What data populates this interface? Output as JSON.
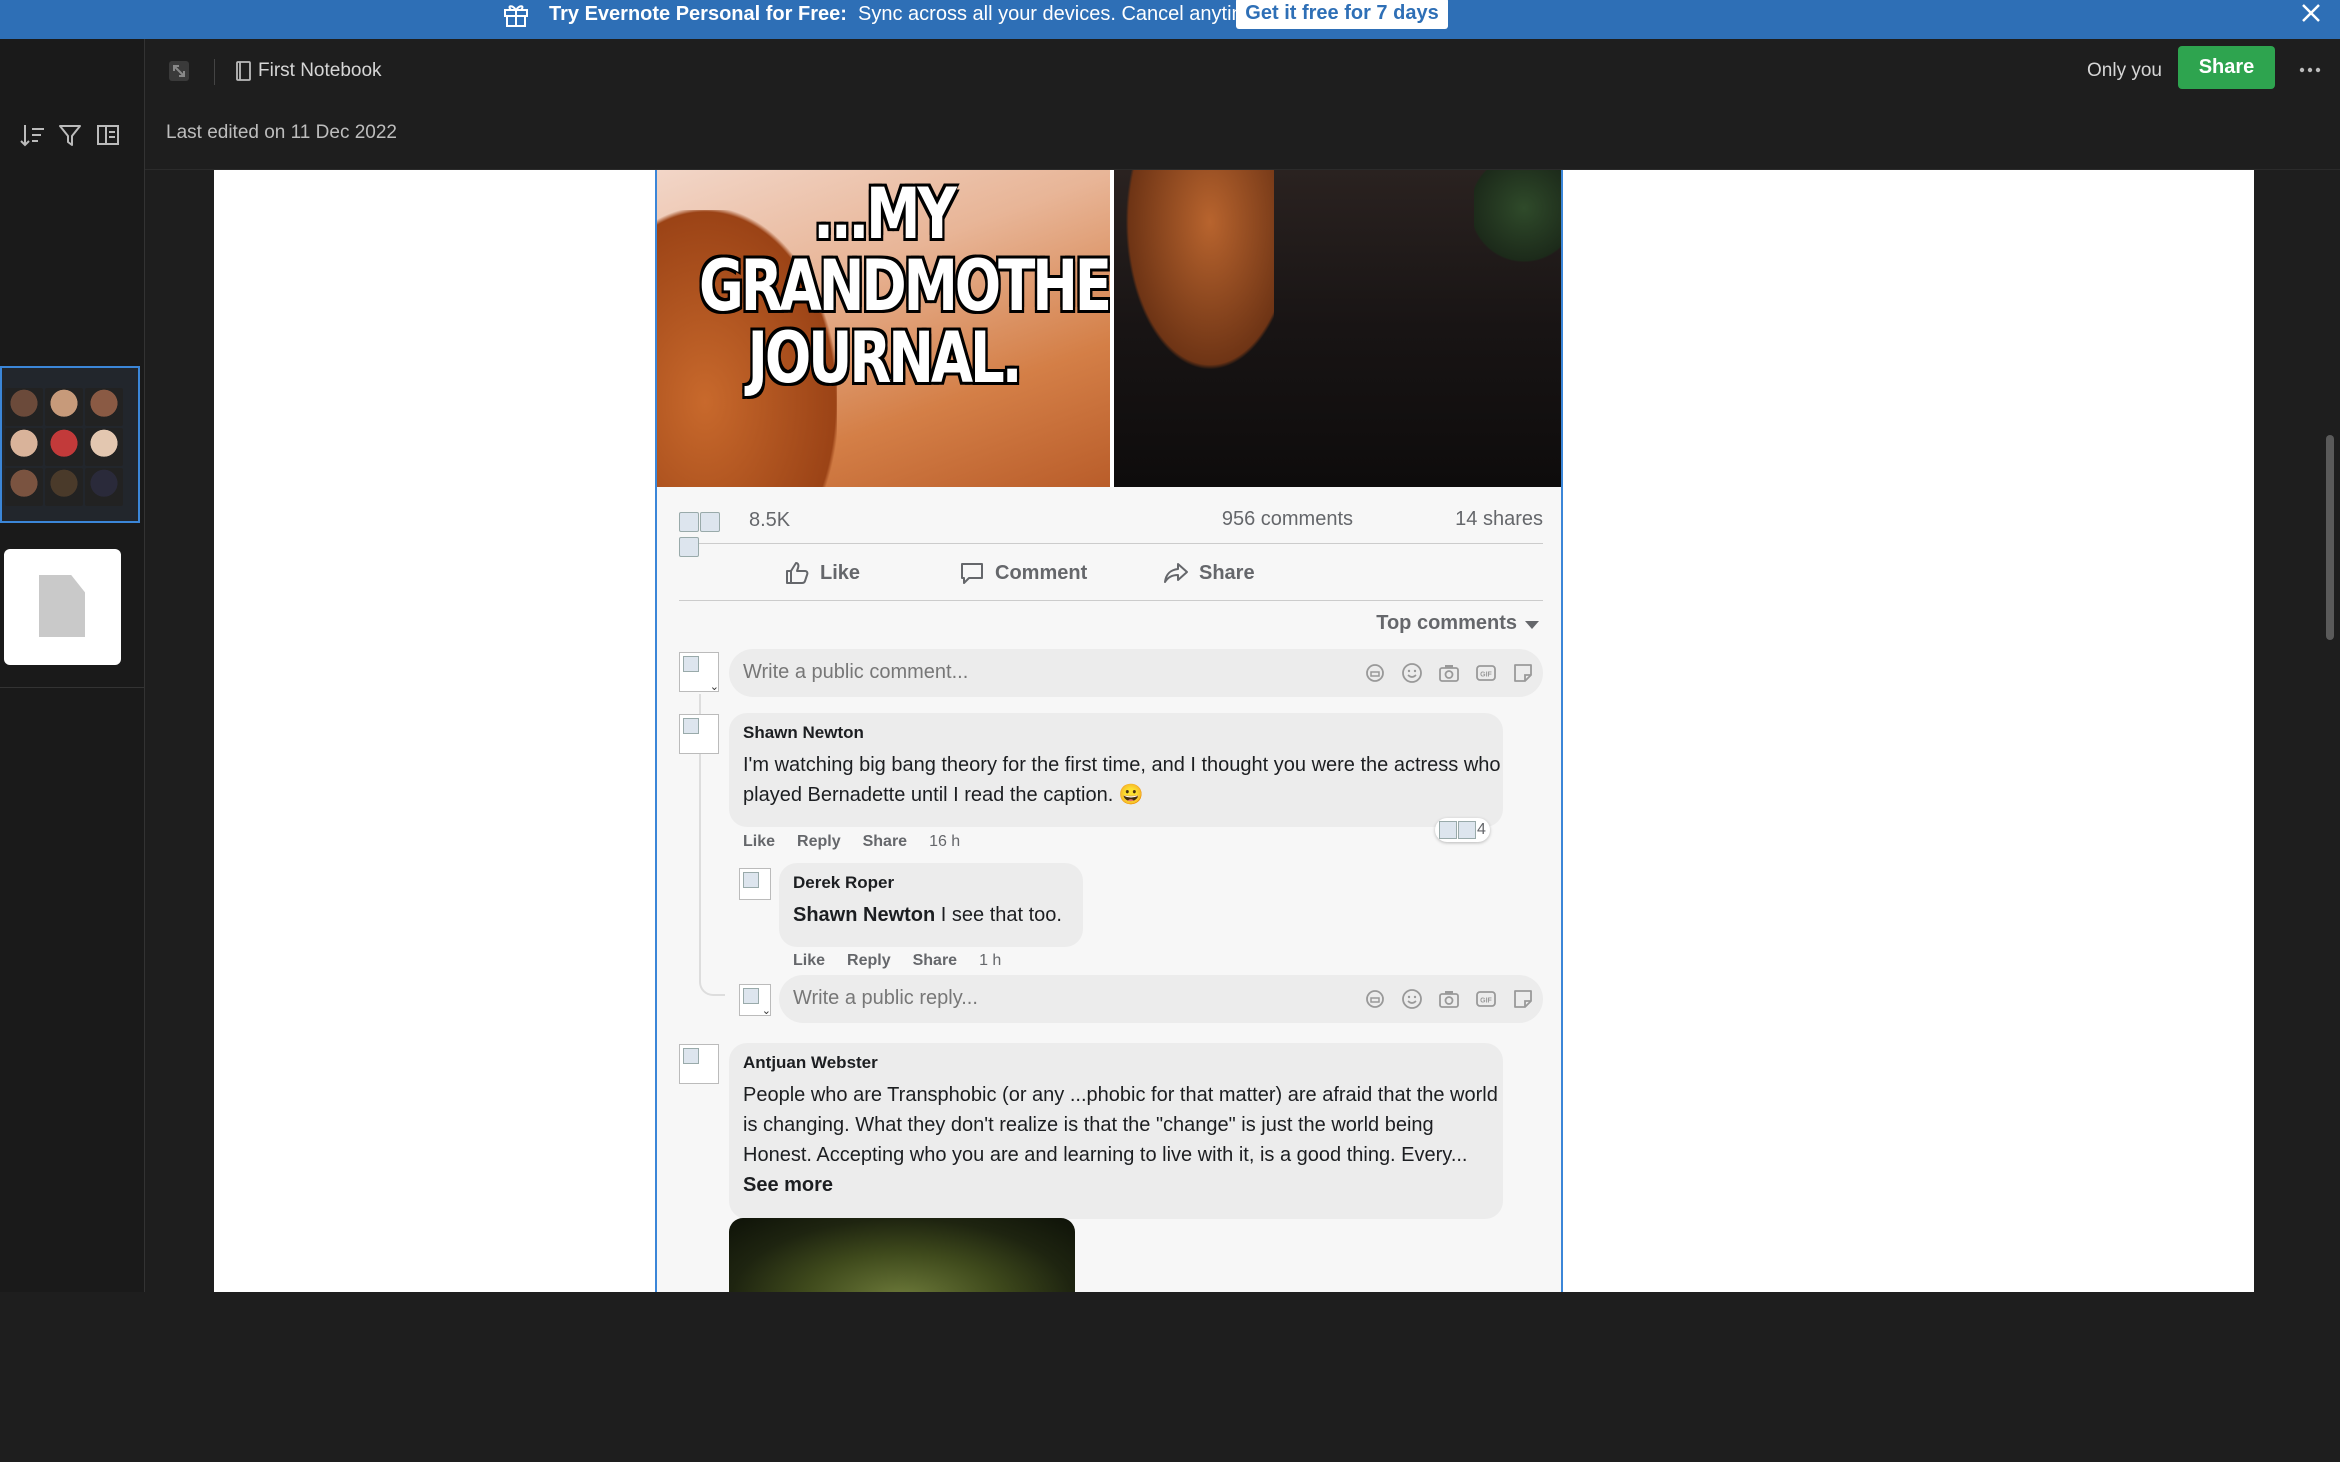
{
  "banner": {
    "title": "Try Evernote Personal for Free:",
    "subtitle": "Sync across all your devices. Cancel anytime.",
    "cta": "Get it free for 7 days",
    "icon": "gift-icon",
    "close_icon": "close-icon"
  },
  "toolbar": {
    "notebook": "First Notebook",
    "last_edited": "Last edited on 11 Dec 2022",
    "visibility": "Only you",
    "share_label": "Share",
    "icons": [
      "expand-icon",
      "notebook-icon",
      "more-icon"
    ]
  },
  "sidebar": {
    "icons": [
      "sort-icon",
      "filter-icon",
      "layout-icon"
    ],
    "thumbnail_colors": [
      "#6b4a3a",
      "#c79a7a",
      "#8a5a44",
      "#d9b39a",
      "#c23a3a",
      "#e3c7b0",
      "#7a5340",
      "#4a3a2a",
      "#2a2a3a"
    ]
  },
  "post": {
    "meme_caption": "...MY\nGRANDMOTHER'S\nJOURNAL.",
    "reactions_count": "8.5K",
    "comments_count": "956 comments",
    "shares_count": "14 shares",
    "actions": {
      "like": "Like",
      "comment": "Comment",
      "share": "Share"
    },
    "sort_label": "Top comments",
    "comment_placeholder": "Write a public comment...",
    "reply_placeholder": "Write a public reply..."
  },
  "comments": [
    {
      "author": "Shawn Newton",
      "text": "I'm watching big bang theory for the first time, and I thought you were the actress who played Bernadette until I read the caption. 😀",
      "actions": [
        "Like",
        "Reply",
        "Share"
      ],
      "time": "16 h",
      "reactions": "4"
    },
    {
      "author": "Derek Roper",
      "mention": "Shawn Newton",
      "text": "I see that too.",
      "actions": [
        "Like",
        "Reply",
        "Share"
      ],
      "time": "1 h"
    },
    {
      "author": "Antjuan Webster",
      "text": "People who are Transphobic (or any ...phobic for that matter) are afraid that the world is changing. What they don't realize is that the \"change\" is just the world being Honest. Accepting who you are and learning to live with it, is a good thing. Every...",
      "see_more": "See more"
    }
  ],
  "colors": {
    "banner": "#2e6fb6",
    "share_button": "#2ea44f",
    "selection": "#3b86d8"
  }
}
